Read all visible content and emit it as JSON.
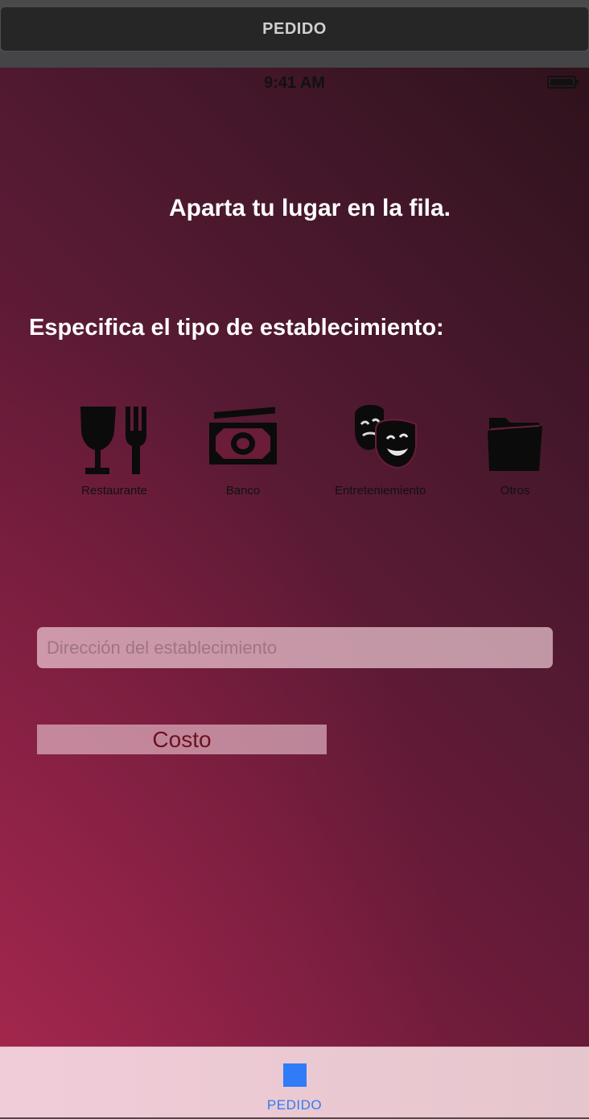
{
  "scene": {
    "title": "PEDIDO"
  },
  "status_bar": {
    "time": "9:41 AM",
    "battery_icon": "battery-full-icon"
  },
  "main": {
    "title": "Aparta tu lugar en la fila.",
    "subtitle": "Especifica el tipo de establecimiento:",
    "categories": [
      {
        "label": "Restaurante",
        "icon": "restaurant-icon"
      },
      {
        "label": "Banco",
        "icon": "money-icon"
      },
      {
        "label": "Entreteniemiento",
        "icon": "theater-masks-icon"
      },
      {
        "label": "Otros",
        "icon": "folder-icon"
      }
    ],
    "address": {
      "value": "",
      "placeholder": "Dirección del establecimiento"
    },
    "cost_button_label": "Costo"
  },
  "tab_bar": {
    "items": [
      {
        "label": "PEDIDO",
        "icon": "square-icon",
        "selected": true
      }
    ]
  },
  "colors": {
    "accent": "#2f7cf6",
    "gradient_dark": "#2e121c",
    "gradient_light": "#a0254c",
    "cost_text": "#6b1020"
  }
}
